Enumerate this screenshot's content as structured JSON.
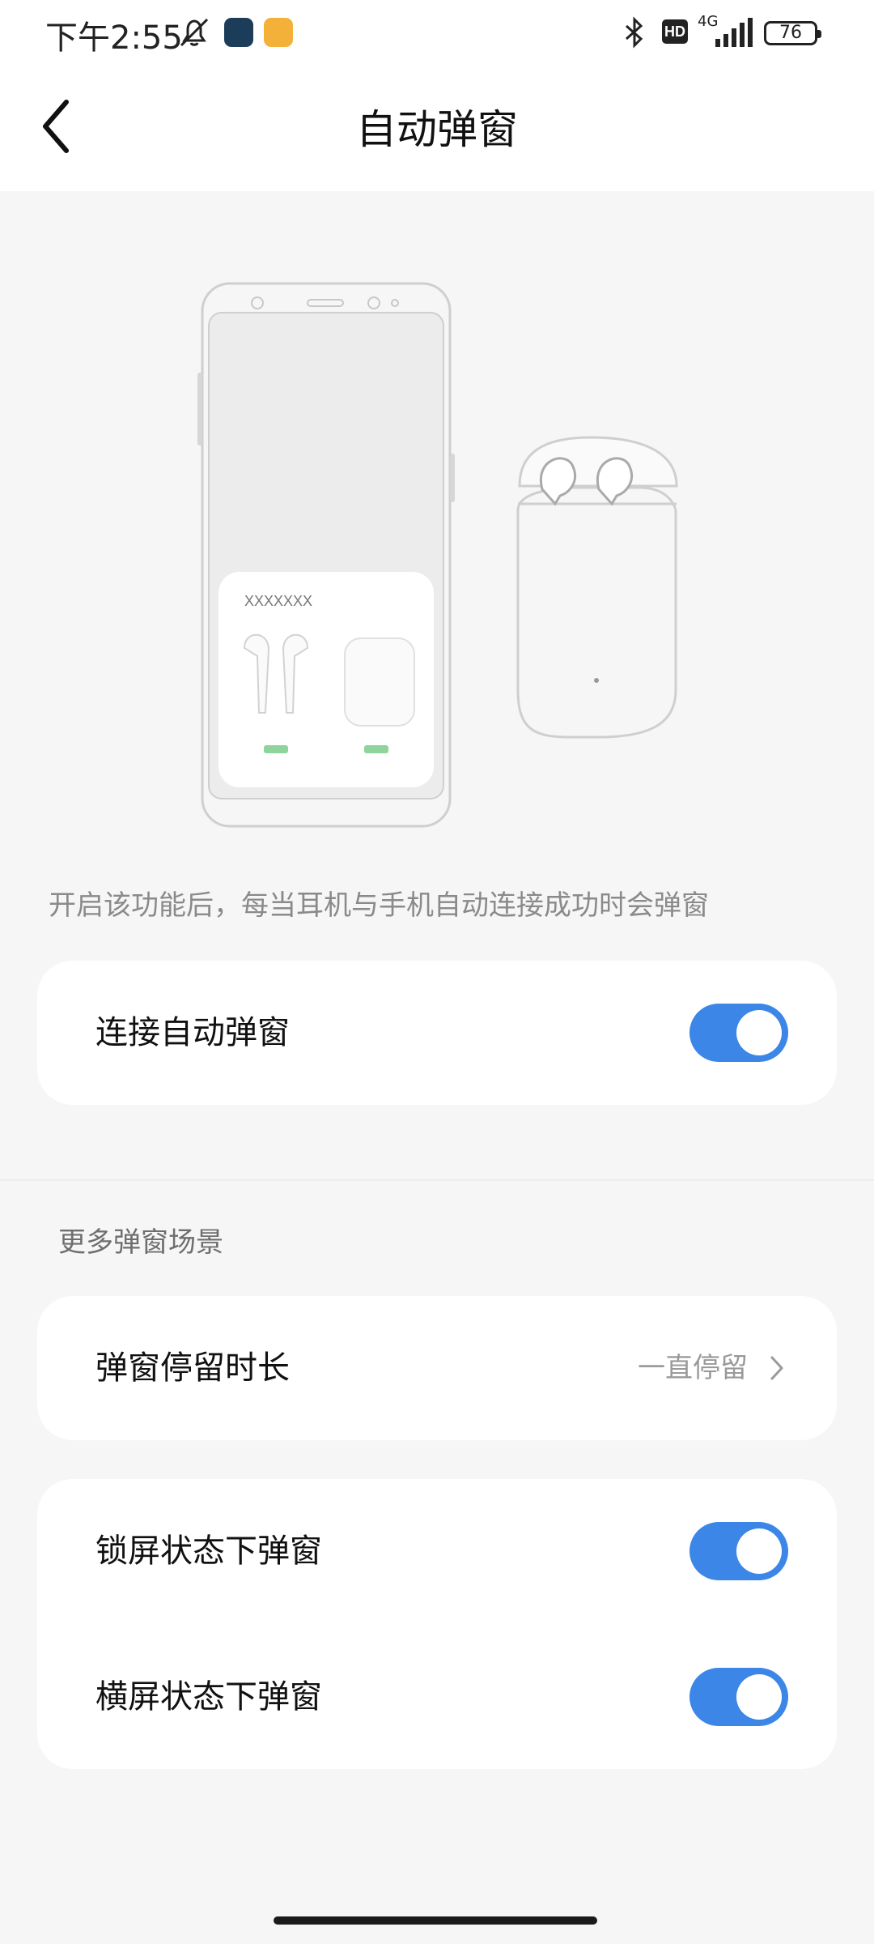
{
  "status_bar": {
    "time": "下午2:55",
    "network": "4G",
    "battery": "76",
    "hd_badge": "HD",
    "icons": [
      "bell-muted-icon",
      "app-shield-icon",
      "app-message-icon",
      "bluetooth-icon",
      "hd-icon",
      "signal-icon",
      "battery-icon"
    ]
  },
  "header": {
    "title": "自动弹窗",
    "back_icon": "chevron-left-icon"
  },
  "illustration": {
    "popup_name": "XXXXXXX"
  },
  "description": "开启该功能后，每当耳机与手机自动连接成功时会弹窗",
  "auto_popup": {
    "label": "连接自动弹窗",
    "enabled": true
  },
  "more_section": {
    "title": "更多弹窗场景"
  },
  "duration": {
    "label": "弹窗停留时长",
    "value": "一直停留"
  },
  "scenes": [
    {
      "label": "锁屏状态下弹窗",
      "enabled": true
    },
    {
      "label": "横屏状态下弹窗",
      "enabled": true
    }
  ],
  "colors": {
    "accent": "#3b86e6",
    "background": "#f6f6f6",
    "card": "#ffffff"
  }
}
